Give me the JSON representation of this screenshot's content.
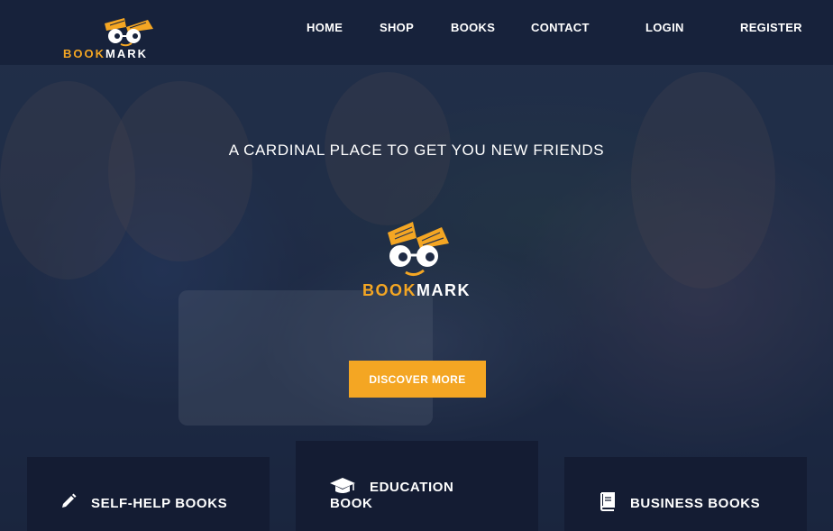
{
  "brand": {
    "part1": "BOOK",
    "part2": "MARK"
  },
  "nav": {
    "items": [
      {
        "label": "HOME"
      },
      {
        "label": "SHOP"
      },
      {
        "label": "BOOKS"
      },
      {
        "label": "CONTACT"
      },
      {
        "label": "LOGIN"
      },
      {
        "label": "REGISTER"
      }
    ]
  },
  "hero": {
    "tagline": "A CARDINAL PLACE TO GET YOU NEW FRIENDS",
    "cta_label": "DISCOVER MORE"
  },
  "categories": [
    {
      "label": "SELF-HELP BOOKS",
      "icon": "pencil-icon"
    },
    {
      "label_line1": "EDUCATION",
      "label_line2": "BOOK",
      "icon": "graduation-cap-icon"
    },
    {
      "label": "BUSINESS BOOKS",
      "icon": "book-icon"
    }
  ],
  "colors": {
    "accent": "#f4a623",
    "navbar": "#17223b",
    "card": "#141c33"
  }
}
